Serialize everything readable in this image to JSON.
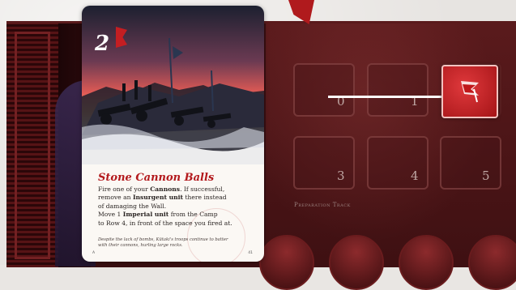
{
  "card": {
    "number": "2",
    "title": "Stone Cannon Balls",
    "rules": [
      [
        {
          "t": "Fire one of your "
        },
        {
          "t": "Cannons",
          "b": true
        },
        {
          "t": ". If successful,"
        }
      ],
      [
        {
          "t": "remove an "
        },
        {
          "t": "Insurgent unit",
          "b": true
        },
        {
          "t": " there instead"
        }
      ],
      [
        {
          "t": "of damaging the Wall."
        }
      ],
      [
        {
          "t": "Move 1 "
        },
        {
          "t": "Imperial unit",
          "b": true
        },
        {
          "t": " from the Camp"
        }
      ],
      [
        {
          "t": "to Row 4, in front of the space you fired at."
        }
      ]
    ],
    "flavor_line1": "Despite the lack of bombs, Kūtaki's troops continue to batter",
    "flavor_line2": "with their cannons, hurling large rocks.",
    "corner_letter": "A",
    "corner_code": "41"
  },
  "board": {
    "track_label": "Preparation Track",
    "spaces": [
      {
        "label": "0",
        "occupied": false
      },
      {
        "label": "1",
        "occupied": false
      },
      {
        "label": "",
        "occupied": true
      },
      {
        "label": "3",
        "occupied": false
      },
      {
        "label": "4",
        "occupied": false
      },
      {
        "label": "5",
        "occupied": false
      }
    ]
  },
  "colors": {
    "card_title": "#b3191c",
    "token": "#d1272b",
    "board": "#3a0f12"
  },
  "icons": {
    "token": "red-banner-icon",
    "arrow": "white-arrow-right-icon"
  }
}
